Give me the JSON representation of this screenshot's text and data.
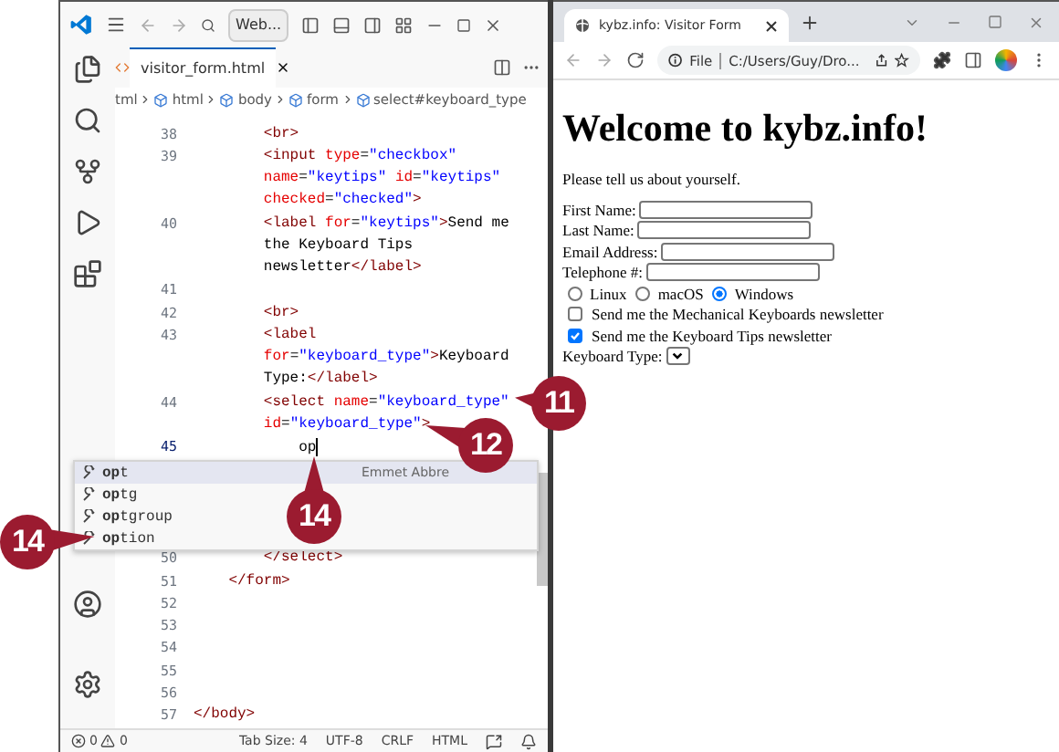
{
  "vscode": {
    "command_center": "Web...",
    "tab": {
      "label": "visitor_form.html"
    },
    "breadcrumb": [
      {
        "label": "tml",
        "icon": false
      },
      {
        "label": "html",
        "icon": true
      },
      {
        "label": "body",
        "icon": true
      },
      {
        "label": "form",
        "icon": true
      },
      {
        "label": "select#keyboard_type",
        "icon": true
      }
    ],
    "lines": [
      {
        "number": "38",
        "cursor": false,
        "rows": [
          {
            "segments": [
              {
                "kind": "tag",
                "text": "        <br>"
              }
            ]
          }
        ]
      },
      {
        "number": "39",
        "cursor": false,
        "rows": [
          {
            "segments": [
              {
                "kind": "tag",
                "text": "        <input "
              },
              {
                "kind": "attr",
                "text": "type"
              },
              {
                "kind": "txt",
                "text": "="
              },
              {
                "kind": "val",
                "text": "\"checkbox\""
              }
            ]
          },
          {
            "segments": [
              {
                "kind": "attr",
                "text": "        name"
              },
              {
                "kind": "txt",
                "text": "="
              },
              {
                "kind": "val",
                "text": "\"keytips\" "
              },
              {
                "kind": "attr",
                "text": "id"
              },
              {
                "kind": "txt",
                "text": "="
              },
              {
                "kind": "val",
                "text": "\"keytips\""
              }
            ]
          },
          {
            "segments": [
              {
                "kind": "attr",
                "text": "        checked"
              },
              {
                "kind": "txt",
                "text": "="
              },
              {
                "kind": "val",
                "text": "\"checked\""
              },
              {
                "kind": "tag",
                "text": ">"
              }
            ]
          }
        ]
      },
      {
        "number": "40",
        "cursor": false,
        "rows": [
          {
            "segments": [
              {
                "kind": "tag",
                "text": "        <label "
              },
              {
                "kind": "attr",
                "text": "for"
              },
              {
                "kind": "txt",
                "text": "="
              },
              {
                "kind": "val",
                "text": "\"keytips\""
              },
              {
                "kind": "tag",
                "text": ">"
              },
              {
                "kind": "txt",
                "text": "Send me"
              }
            ]
          },
          {
            "segments": [
              {
                "kind": "txt",
                "text": "        the Keyboard Tips"
              }
            ]
          },
          {
            "segments": [
              {
                "kind": "txt",
                "text": "        newsletter"
              },
              {
                "kind": "tag",
                "text": "</label>"
              }
            ]
          }
        ]
      },
      {
        "number": "41",
        "cursor": false,
        "rows": [
          {
            "segments": []
          }
        ]
      },
      {
        "number": "42",
        "cursor": false,
        "rows": [
          {
            "segments": [
              {
                "kind": "tag",
                "text": "        <br>"
              }
            ]
          }
        ]
      },
      {
        "number": "43",
        "cursor": false,
        "rows": [
          {
            "segments": [
              {
                "kind": "tag",
                "text": "        <label"
              }
            ]
          },
          {
            "segments": [
              {
                "kind": "attr",
                "text": "        for"
              },
              {
                "kind": "txt",
                "text": "="
              },
              {
                "kind": "val",
                "text": "\"keyboard_type\""
              },
              {
                "kind": "tag",
                "text": ">"
              },
              {
                "kind": "txt",
                "text": "Keyboard"
              }
            ]
          },
          {
            "segments": [
              {
                "kind": "txt",
                "text": "        Type:"
              },
              {
                "kind": "tag",
                "text": "</label>"
              }
            ]
          }
        ]
      },
      {
        "number": "44",
        "cursor": false,
        "rows": [
          {
            "segments": [
              {
                "kind": "tag",
                "text": "        <select "
              },
              {
                "kind": "attr",
                "text": "name"
              },
              {
                "kind": "txt",
                "text": "="
              },
              {
                "kind": "val",
                "text": "\"keyboard_type\""
              }
            ]
          },
          {
            "segments": [
              {
                "kind": "attr",
                "text": "        id"
              },
              {
                "kind": "txt",
                "text": "="
              },
              {
                "kind": "val",
                "text": "\"keyboard_type\""
              },
              {
                "kind": "tag",
                "text": ">"
              }
            ]
          }
        ]
      },
      {
        "number": "45",
        "cursor": true,
        "rows": [
          {
            "segments": [
              {
                "kind": "txt",
                "text": "            op"
              }
            ]
          }
        ]
      },
      {
        "number": "50",
        "cursor": false,
        "rows": [
          {
            "segments": [
              {
                "kind": "tag",
                "text": "        </select>"
              }
            ]
          }
        ]
      },
      {
        "number": "51",
        "cursor": false,
        "rows": [
          {
            "segments": [
              {
                "kind": "tag",
                "text": "    </form>"
              }
            ]
          }
        ]
      },
      {
        "number": "52",
        "cursor": false,
        "rows": [
          {
            "segments": []
          }
        ]
      },
      {
        "number": "53",
        "cursor": false,
        "rows": [
          {
            "segments": []
          }
        ]
      },
      {
        "number": "54",
        "cursor": false,
        "rows": [
          {
            "segments": []
          }
        ]
      },
      {
        "number": "55",
        "cursor": false,
        "rows": [
          {
            "segments": []
          }
        ]
      },
      {
        "number": "56",
        "cursor": false,
        "rows": [
          {
            "segments": []
          }
        ]
      },
      {
        "number": "57",
        "cursor": false,
        "rows": [
          {
            "segments": [
              {
                "kind": "tag",
                "text": "</body>"
              }
            ]
          }
        ]
      }
    ],
    "suggestions": [
      {
        "label": "**op**t",
        "detail": "Emmet Abbre",
        "selected": true
      },
      {
        "label": "**op**tg",
        "selected": false
      },
      {
        "label": "**op**tgroup",
        "selected": false
      },
      {
        "label": "**op**tion",
        "selected": false
      }
    ],
    "status_bar": {
      "errors": "0",
      "warnings": "0",
      "items": [
        "Tab Size: 4",
        "UTF-8",
        "CRLF",
        "HTML"
      ]
    }
  },
  "browser": {
    "tab": {
      "title": "kybz.info: Visitor Form"
    },
    "address": {
      "scheme": "File",
      "url": "C:/Users/Guy/Dro..."
    },
    "page": {
      "heading": "Welcome to kybz.info!",
      "intro": "Please tell us about yourself.",
      "fields": [
        {
          "label": "First Name:"
        },
        {
          "label": "Last Name:"
        },
        {
          "label": "Email Address:"
        },
        {
          "label": "Telephone #:"
        }
      ],
      "radios": [
        {
          "label": "Linux",
          "selected": false
        },
        {
          "label": "macOS",
          "selected": false
        },
        {
          "label": "Windows",
          "selected": true
        }
      ],
      "checkboxes": [
        {
          "label": "Send me the Mechanical Keyboards newsletter",
          "checked": false
        },
        {
          "label": "Send me the Keyboard Tips newsletter",
          "checked": true
        }
      ],
      "select_label": "Keyboard Type:"
    }
  },
  "callouts": [
    "11",
    "12",
    "14",
    "14"
  ]
}
